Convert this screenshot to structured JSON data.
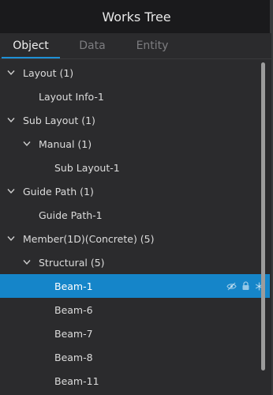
{
  "window": {
    "title": "Works Tree"
  },
  "tabs": [
    {
      "label": "Object",
      "active": true
    },
    {
      "label": "Data",
      "active": false
    },
    {
      "label": "Entity",
      "active": false
    }
  ],
  "tree": [
    {
      "label": "Layout (1)",
      "level": 0,
      "expanded": true
    },
    {
      "label": "Layout Info-1",
      "level": 1
    },
    {
      "label": "Sub Layout (1)",
      "level": 0,
      "expanded": true
    },
    {
      "label": "Manual (1)",
      "level": 1,
      "expanded": true
    },
    {
      "label": "Sub Layout-1",
      "level": 2
    },
    {
      "label": "Guide Path (1)",
      "level": 0,
      "expanded": true
    },
    {
      "label": "Guide Path-1",
      "level": 1
    },
    {
      "label": "Member(1D)(Concrete) (5)",
      "level": 0,
      "expanded": true
    },
    {
      "label": "Structural (5)",
      "level": 1,
      "expanded": true
    },
    {
      "label": "Beam-1",
      "level": 2,
      "selected": true,
      "icons": [
        "visibility-off-icon",
        "lock-icon",
        "asterisk-icon"
      ]
    },
    {
      "label": "Beam-6",
      "level": 2
    },
    {
      "label": "Beam-7",
      "level": 2
    },
    {
      "label": "Beam-8",
      "level": 2
    },
    {
      "label": "Beam-11",
      "level": 2
    }
  ],
  "colors": {
    "background": "#2b2b2d",
    "titlebar": "#1a1a1c",
    "selection": "#1585c9",
    "tab_underline": "#1e90d6"
  }
}
